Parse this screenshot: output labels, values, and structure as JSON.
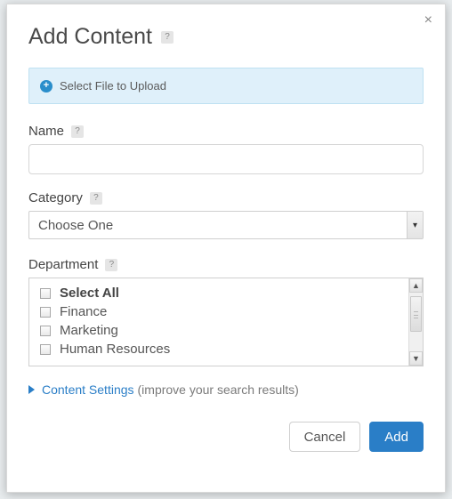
{
  "dialog": {
    "title": "Add Content",
    "close_glyph": "×"
  },
  "upload": {
    "plus_glyph": "+",
    "label": "Select File to Upload"
  },
  "name_field": {
    "label": "Name",
    "value": ""
  },
  "category_field": {
    "label": "Category",
    "selected": "Choose One",
    "arrow_glyph": "▾"
  },
  "department_field": {
    "label": "Department",
    "items": [
      {
        "label": "Select All",
        "bold": true
      },
      {
        "label": "Finance",
        "bold": false
      },
      {
        "label": "Marketing",
        "bold": false
      },
      {
        "label": "Human Resources",
        "bold": false
      }
    ],
    "scroll": {
      "up_glyph": "▲",
      "down_glyph": "▼"
    }
  },
  "settings": {
    "link": "Content Settings",
    "hint": "(improve your search results)"
  },
  "buttons": {
    "cancel": "Cancel",
    "add": "Add"
  },
  "help_glyph": "?"
}
